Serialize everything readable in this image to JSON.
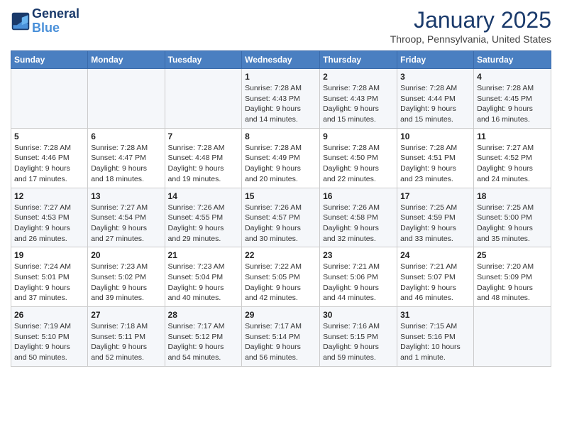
{
  "header": {
    "logo_line1": "General",
    "logo_line2": "Blue",
    "month": "January 2025",
    "location": "Throop, Pennsylvania, United States"
  },
  "weekdays": [
    "Sunday",
    "Monday",
    "Tuesday",
    "Wednesday",
    "Thursday",
    "Friday",
    "Saturday"
  ],
  "weeks": [
    [
      {
        "day": "",
        "info": ""
      },
      {
        "day": "",
        "info": ""
      },
      {
        "day": "",
        "info": ""
      },
      {
        "day": "1",
        "info": "Sunrise: 7:28 AM\nSunset: 4:43 PM\nDaylight: 9 hours\nand 14 minutes."
      },
      {
        "day": "2",
        "info": "Sunrise: 7:28 AM\nSunset: 4:43 PM\nDaylight: 9 hours\nand 15 minutes."
      },
      {
        "day": "3",
        "info": "Sunrise: 7:28 AM\nSunset: 4:44 PM\nDaylight: 9 hours\nand 15 minutes."
      },
      {
        "day": "4",
        "info": "Sunrise: 7:28 AM\nSunset: 4:45 PM\nDaylight: 9 hours\nand 16 minutes."
      }
    ],
    [
      {
        "day": "5",
        "info": "Sunrise: 7:28 AM\nSunset: 4:46 PM\nDaylight: 9 hours\nand 17 minutes."
      },
      {
        "day": "6",
        "info": "Sunrise: 7:28 AM\nSunset: 4:47 PM\nDaylight: 9 hours\nand 18 minutes."
      },
      {
        "day": "7",
        "info": "Sunrise: 7:28 AM\nSunset: 4:48 PM\nDaylight: 9 hours\nand 19 minutes."
      },
      {
        "day": "8",
        "info": "Sunrise: 7:28 AM\nSunset: 4:49 PM\nDaylight: 9 hours\nand 20 minutes."
      },
      {
        "day": "9",
        "info": "Sunrise: 7:28 AM\nSunset: 4:50 PM\nDaylight: 9 hours\nand 22 minutes."
      },
      {
        "day": "10",
        "info": "Sunrise: 7:28 AM\nSunset: 4:51 PM\nDaylight: 9 hours\nand 23 minutes."
      },
      {
        "day": "11",
        "info": "Sunrise: 7:27 AM\nSunset: 4:52 PM\nDaylight: 9 hours\nand 24 minutes."
      }
    ],
    [
      {
        "day": "12",
        "info": "Sunrise: 7:27 AM\nSunset: 4:53 PM\nDaylight: 9 hours\nand 26 minutes."
      },
      {
        "day": "13",
        "info": "Sunrise: 7:27 AM\nSunset: 4:54 PM\nDaylight: 9 hours\nand 27 minutes."
      },
      {
        "day": "14",
        "info": "Sunrise: 7:26 AM\nSunset: 4:55 PM\nDaylight: 9 hours\nand 29 minutes."
      },
      {
        "day": "15",
        "info": "Sunrise: 7:26 AM\nSunset: 4:57 PM\nDaylight: 9 hours\nand 30 minutes."
      },
      {
        "day": "16",
        "info": "Sunrise: 7:26 AM\nSunset: 4:58 PM\nDaylight: 9 hours\nand 32 minutes."
      },
      {
        "day": "17",
        "info": "Sunrise: 7:25 AM\nSunset: 4:59 PM\nDaylight: 9 hours\nand 33 minutes."
      },
      {
        "day": "18",
        "info": "Sunrise: 7:25 AM\nSunset: 5:00 PM\nDaylight: 9 hours\nand 35 minutes."
      }
    ],
    [
      {
        "day": "19",
        "info": "Sunrise: 7:24 AM\nSunset: 5:01 PM\nDaylight: 9 hours\nand 37 minutes."
      },
      {
        "day": "20",
        "info": "Sunrise: 7:23 AM\nSunset: 5:02 PM\nDaylight: 9 hours\nand 39 minutes."
      },
      {
        "day": "21",
        "info": "Sunrise: 7:23 AM\nSunset: 5:04 PM\nDaylight: 9 hours\nand 40 minutes."
      },
      {
        "day": "22",
        "info": "Sunrise: 7:22 AM\nSunset: 5:05 PM\nDaylight: 9 hours\nand 42 minutes."
      },
      {
        "day": "23",
        "info": "Sunrise: 7:21 AM\nSunset: 5:06 PM\nDaylight: 9 hours\nand 44 minutes."
      },
      {
        "day": "24",
        "info": "Sunrise: 7:21 AM\nSunset: 5:07 PM\nDaylight: 9 hours\nand 46 minutes."
      },
      {
        "day": "25",
        "info": "Sunrise: 7:20 AM\nSunset: 5:09 PM\nDaylight: 9 hours\nand 48 minutes."
      }
    ],
    [
      {
        "day": "26",
        "info": "Sunrise: 7:19 AM\nSunset: 5:10 PM\nDaylight: 9 hours\nand 50 minutes."
      },
      {
        "day": "27",
        "info": "Sunrise: 7:18 AM\nSunset: 5:11 PM\nDaylight: 9 hours\nand 52 minutes."
      },
      {
        "day": "28",
        "info": "Sunrise: 7:17 AM\nSunset: 5:12 PM\nDaylight: 9 hours\nand 54 minutes."
      },
      {
        "day": "29",
        "info": "Sunrise: 7:17 AM\nSunset: 5:14 PM\nDaylight: 9 hours\nand 56 minutes."
      },
      {
        "day": "30",
        "info": "Sunrise: 7:16 AM\nSunset: 5:15 PM\nDaylight: 9 hours\nand 59 minutes."
      },
      {
        "day": "31",
        "info": "Sunrise: 7:15 AM\nSunset: 5:16 PM\nDaylight: 10 hours\nand 1 minute."
      },
      {
        "day": "",
        "info": ""
      }
    ]
  ]
}
